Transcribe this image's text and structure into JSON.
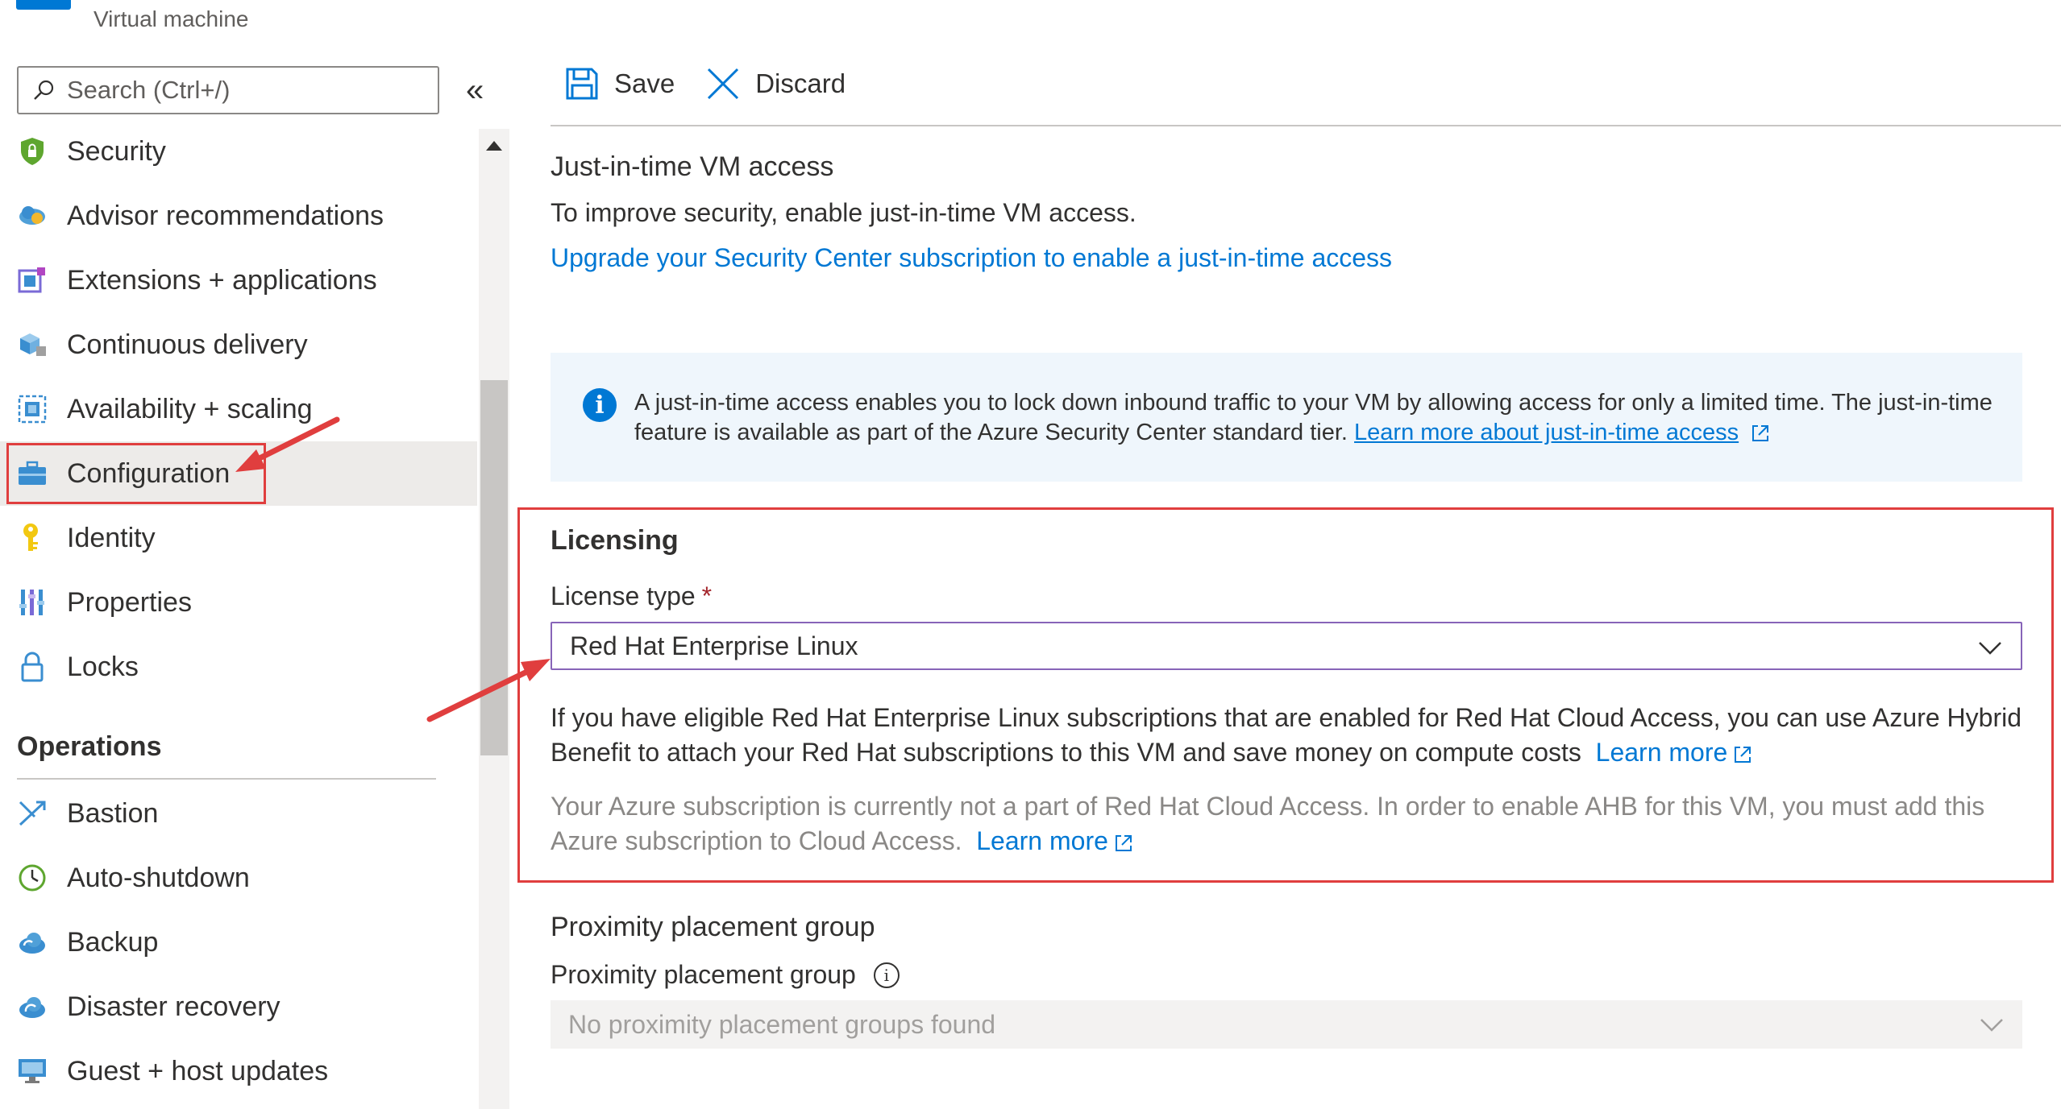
{
  "header": {
    "subtitle": "Virtual machine"
  },
  "search": {
    "placeholder": "Search (Ctrl+/)"
  },
  "sidebar": {
    "items": [
      {
        "label": "Security",
        "icon": "shield-icon"
      },
      {
        "label": "Advisor recommendations",
        "icon": "cloud-advisor-icon"
      },
      {
        "label": "Extensions + applications",
        "icon": "extensions-icon"
      },
      {
        "label": "Continuous delivery",
        "icon": "cube-delivery-icon"
      },
      {
        "label": "Availability + scaling",
        "icon": "scaling-icon"
      },
      {
        "label": "Configuration",
        "icon": "toolbox-icon",
        "active": true
      },
      {
        "label": "Identity",
        "icon": "key-icon"
      },
      {
        "label": "Properties",
        "icon": "properties-bars-icon"
      },
      {
        "label": "Locks",
        "icon": "lock-icon"
      }
    ],
    "operations_header": "Operations",
    "operations": [
      {
        "label": "Bastion",
        "icon": "bastion-icon"
      },
      {
        "label": "Auto-shutdown",
        "icon": "clock-icon"
      },
      {
        "label": "Backup",
        "icon": "cloud-backup-icon"
      },
      {
        "label": "Disaster recovery",
        "icon": "cloud-recovery-icon"
      },
      {
        "label": "Guest + host updates",
        "icon": "monitor-update-icon"
      }
    ]
  },
  "toolbar": {
    "save_label": "Save",
    "discard_label": "Discard"
  },
  "jit": {
    "title": "Just-in-time VM access",
    "text": "To improve security, enable just-in-time VM access.",
    "link": "Upgrade your Security Center subscription to enable a just-in-time access"
  },
  "info": {
    "text": "A just-in-time access enables you to lock down inbound traffic to your VM by allowing access for only a limited time. The just-in-time feature is available as part of the Azure Security Center standard tier.",
    "link": "Learn more about just-in-time access"
  },
  "licensing": {
    "title": "Licensing",
    "license_type_label": "License type",
    "required_mark": "*",
    "selected_value": "Red Hat Enterprise Linux",
    "description": "If you have eligible Red Hat Enterprise Linux subscriptions that are enabled for Red Hat Cloud Access, you can use Azure Hybrid Benefit to attach your Red Hat subscriptions to this VM and save money on compute costs",
    "description_link": "Learn more",
    "note": "Your Azure subscription is currently not a part of Red Hat Cloud Access. In order to enable AHB for this VM, you must add this Azure subscription to Cloud Access.",
    "note_link": "Learn more"
  },
  "proximity": {
    "title": "Proximity placement group",
    "label": "Proximity placement group",
    "placeholder": "No proximity placement groups found"
  },
  "colors": {
    "accent": "#0078d4",
    "highlight": "#e03e3e",
    "dropdown_border": "#8764b8"
  }
}
